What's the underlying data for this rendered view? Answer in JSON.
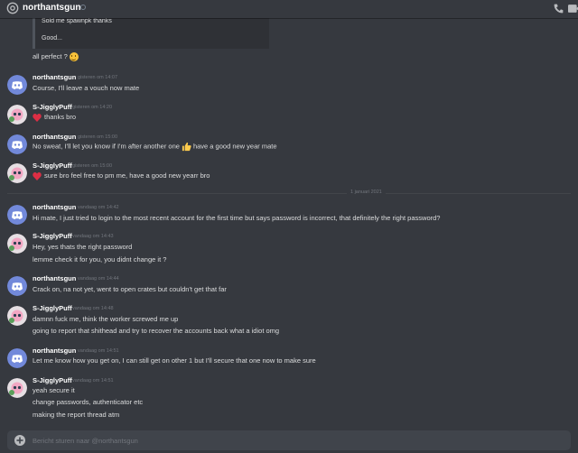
{
  "header": {
    "channel_name": "northantsgun"
  },
  "quote": {
    "lines": [
      "Sold me spawnpk thanks",
      "Good..."
    ]
  },
  "loose_message": "all perfect ?",
  "messages": [
    {
      "author": "northantsgun",
      "timestamp": "gisteren om 14:07",
      "lines": [
        "Course, I'll leave a vouch now mate"
      ]
    },
    {
      "author": "S-JigglyPuff",
      "timestamp": "gisteren om 14:20",
      "lines": [
        "thanks bro"
      ]
    },
    {
      "author": "northantsgun",
      "timestamp": "gisteren om 15:00",
      "line_before": "No sweat, I'll let you know if I'm after another one",
      "line_after": "have a good new year mate"
    },
    {
      "author": "S-JigglyPuff",
      "timestamp": "gisteren om 15:00",
      "lines": [
        "sure bro feel free to pm me, have a good new yearr bro"
      ]
    },
    {
      "author": "northantsgun",
      "timestamp": "vandaag om 14:42",
      "lines": [
        "Hi mate, I just tried to login to the most recent account for the first time but says password is incorrect, that definitely the right password?"
      ]
    },
    {
      "author": "S-JigglyPuff",
      "timestamp": "vandaag om 14:43",
      "lines": [
        "Hey, yes thats the right password",
        "lemme check it for you, you didnt change it ?"
      ]
    },
    {
      "author": "northantsgun",
      "timestamp": "vandaag om 14:44",
      "lines": [
        "Crack on, na not yet, went to open crates but couldn't get that far"
      ]
    },
    {
      "author": "S-JigglyPuff",
      "timestamp": "vandaag om 14:48",
      "lines": [
        "damnn fuck me, think the worker screwed me up",
        "going to report that shithead and try to recover the accounts back what a idiot omg"
      ]
    },
    {
      "author": "northantsgun",
      "timestamp": "vandaag om 14:51",
      "lines": [
        "Let me know how you get on, I can still get on other 1 but I'll secure that one now to make sure"
      ]
    },
    {
      "author": "S-JigglyPuff",
      "timestamp": "vandaag om 14:51",
      "lines": [
        "yeah secure it",
        "change passwords, authenticator etc",
        "making the report thread atm"
      ]
    }
  ],
  "date_divider": "1 januari 2021",
  "composer": {
    "placeholder": "Bericht sturen naar @northantsgun"
  },
  "icons": {
    "mention": "at-icon",
    "status": "status-indicator-icon",
    "call": "phone-call-icon",
    "video": "video-call-icon",
    "add": "add-attachment-icon",
    "heart": "heart-emoji-icon",
    "thumbs": "thumbs-up-emoji-icon",
    "smile": "smile-emoji-icon"
  },
  "colors": {
    "background": "#36393f",
    "discord_blurple": "#7289da",
    "text": "#dcddde",
    "muted": "#72767d",
    "heart": "#dd2e44",
    "composer": "#40444b"
  }
}
